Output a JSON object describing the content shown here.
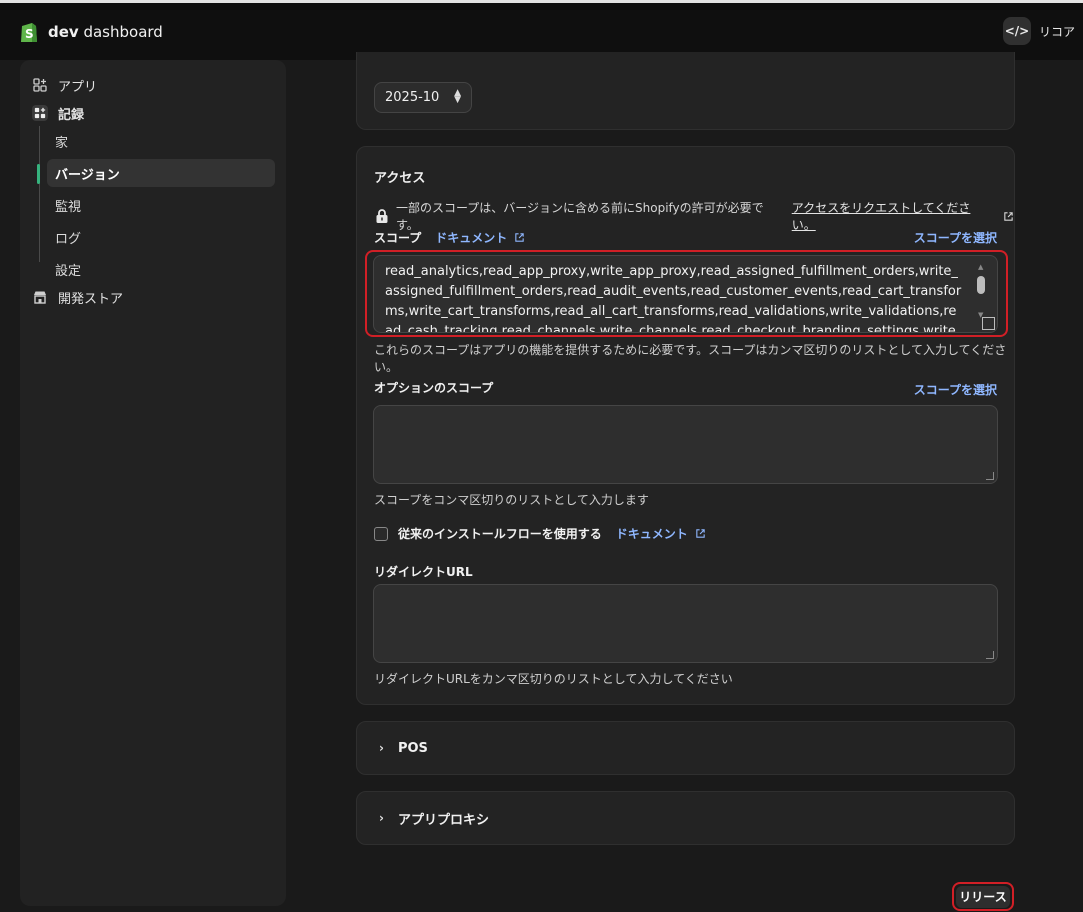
{
  "topbar": {
    "brand_bold": "dev",
    "brand_rest": " dashboard",
    "store_name": "リコア",
    "code_button_glyph": "</>"
  },
  "sidebar": {
    "items": [
      {
        "label": "アプリ",
        "icon": "apps-icon"
      },
      {
        "label": "記録",
        "icon": "apps-grid-icon"
      },
      {
        "label": "開発ストア",
        "icon": "store-icon"
      }
    ],
    "sub_items": [
      {
        "label": "家"
      },
      {
        "label": "バージョン",
        "active": true
      },
      {
        "label": "監視"
      },
      {
        "label": "ログ"
      },
      {
        "label": "設定"
      }
    ]
  },
  "webhook": {
    "api_version": "2025-10"
  },
  "access": {
    "title": "アクセス",
    "notice_text": "一部のスコープは、バージョンに含める前にShopifyの許可が必要です。",
    "notice_link": "アクセスをリクエストしてください。",
    "scopes_label": "スコープ",
    "doc_link": "ドキュメント",
    "select_scopes": "スコープを選択",
    "scopes_value": "read_analytics,read_app_proxy,write_app_proxy,read_assigned_fulfillment_orders,write_assigned_fulfillment_orders,read_audit_events,read_customer_events,read_cart_transforms,write_cart_transforms,read_all_cart_transforms,read_validations,write_validations,read_cash_tracking,read_channels,write_channels,read_checkout_branding_settings,write_checkout_branding_settings,w",
    "scopes_help": "これらのスコープはアプリの機能を提供するために必要です。スコープはカンマ区切りのリストとして入力してください。",
    "optional_label": "オプションのスコープ",
    "optional_select": "スコープを選択",
    "optional_help": "スコープをコンマ区切りのリストとして入力します",
    "legacy_label": "従来のインストールフローを使用する",
    "legacy_doc": "ドキュメント",
    "redirect_label": "リダイレクトURL",
    "redirect_help": "リダイレクトURLをカンマ区切りのリストとして入力してください"
  },
  "sections": [
    {
      "label": "POS"
    },
    {
      "label": "アプリプロキシ"
    }
  ],
  "release_button": "リリース",
  "colors": {
    "accent_link": "#8fb7ff",
    "active_indicator": "#36b37e",
    "highlight": "#d11f26"
  }
}
